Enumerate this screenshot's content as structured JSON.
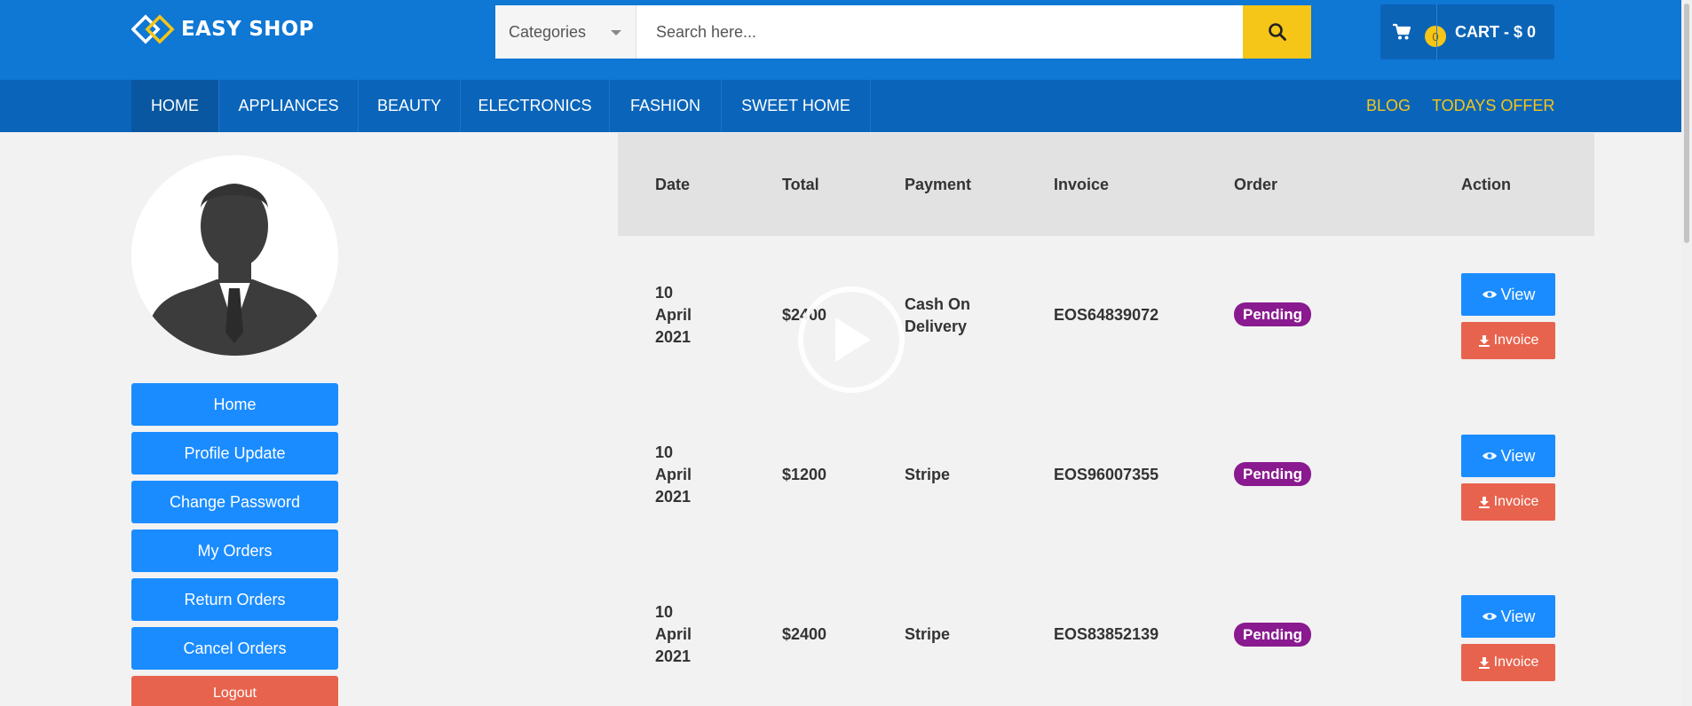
{
  "brand": {
    "name": "EASY SHOP"
  },
  "search": {
    "category_label": "Categories",
    "placeholder": "Search here...",
    "button_icon": "search-icon"
  },
  "cart": {
    "count": "0",
    "label": "CART - $ 0"
  },
  "nav": {
    "items": [
      "HOME",
      "APPLIANCES",
      "BEAUTY",
      "ELECTRONICS",
      "FASHION",
      "SWEET HOME"
    ],
    "active": "HOME",
    "right": [
      "BLOG",
      "TODAYS OFFER"
    ]
  },
  "sidebar": {
    "buttons": [
      "Home",
      "Profile Update",
      "Change Password",
      "My Orders",
      "Return Orders",
      "Cancel Orders"
    ],
    "logout": "Logout"
  },
  "orders": {
    "headers": [
      "Date",
      "Total",
      "Payment",
      "Invoice",
      "Order",
      "Action"
    ],
    "rows": [
      {
        "date": [
          "10",
          "April",
          "2021"
        ],
        "total": "$2400",
        "payment": "Cash On Delivery",
        "invoice": "EOS64839072",
        "status": "Pending"
      },
      {
        "date": [
          "10",
          "April",
          "2021"
        ],
        "total": "$1200",
        "payment": "Stripe",
        "invoice": "EOS96007355",
        "status": "Pending"
      },
      {
        "date": [
          "10",
          "April",
          "2021"
        ],
        "total": "$2400",
        "payment": "Stripe",
        "invoice": "EOS83852139",
        "status": "Pending"
      }
    ],
    "view_label": "View",
    "invoice_label": "Invoice"
  },
  "colors": {
    "topbar": "#0f77d4",
    "navbar": "#0a65ba",
    "accent_yellow": "#f5c518",
    "primary_button": "#1a8cff",
    "danger_button": "#e8634e",
    "badge_pending": "#8a1a8f"
  }
}
